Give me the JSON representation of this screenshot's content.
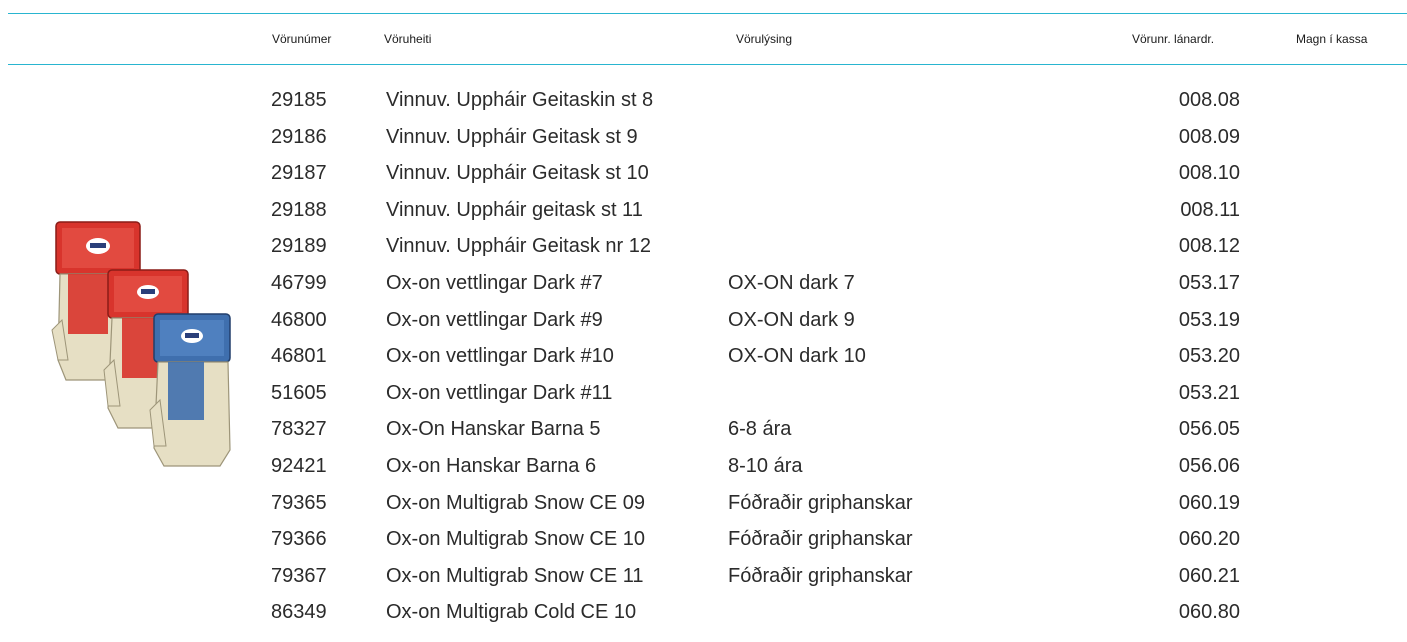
{
  "table": {
    "headers": {
      "number": "Vörunúmer",
      "name": "Vöruheiti",
      "description": "Vörulýsing",
      "supplier_no": "Vörunr. lánardr.",
      "quantity": "Magn í kassa"
    },
    "rows": [
      {
        "number": "29185",
        "name": "Vinnuv. Uppháir Geitaskin st 8",
        "description": "",
        "supplier_no": "008.08"
      },
      {
        "number": "29186",
        "name": "Vinnuv. Uppháir Geitask st 9",
        "description": "",
        "supplier_no": "008.09"
      },
      {
        "number": "29187",
        "name": "Vinnuv. Uppháir Geitask st 10",
        "description": "",
        "supplier_no": "008.10"
      },
      {
        "number": "29188",
        "name": "Vinnuv. Uppháir geitask st 11",
        "description": "",
        "supplier_no": "008.11"
      },
      {
        "number": "29189",
        "name": "Vinnuv. Uppháir Geitask nr 12",
        "description": "",
        "supplier_no": "008.12"
      },
      {
        "number": "46799",
        "name": "Ox-on vettlingar Dark #7",
        "description": "OX-ON dark 7",
        "supplier_no": "053.17"
      },
      {
        "number": "46800",
        "name": "Ox-on vettlingar Dark #9",
        "description": "OX-ON dark 9",
        "supplier_no": "053.19"
      },
      {
        "number": "46801",
        "name": "Ox-on vettlingar Dark #10",
        "description": "OX-ON dark 10",
        "supplier_no": "053.20"
      },
      {
        "number": "51605",
        "name": "Ox-on vettlingar Dark #11",
        "description": "",
        "supplier_no": "053.21"
      },
      {
        "number": "78327",
        "name": "Ox-On Hanskar Barna 5",
        "description": "6-8 ára",
        "supplier_no": "056.05"
      },
      {
        "number": "92421",
        "name": "Ox-on Hanskar Barna 6",
        "description": "8-10 ára",
        "supplier_no": "056.06"
      },
      {
        "number": "79365",
        "name": "Ox-on Multigrab Snow CE 09",
        "description": "Fóðraðir griphanskar",
        "supplier_no": "060.19"
      },
      {
        "number": "79366",
        "name": "Ox-on Multigrab Snow CE 10",
        "description": "Fóðraðir griphanskar",
        "supplier_no": "060.20"
      },
      {
        "number": "79367",
        "name": "Ox-on Multigrab Snow CE 11",
        "description": "Fóðraðir griphanskar",
        "supplier_no": "060.21"
      },
      {
        "number": "86349",
        "name": "Ox-on Multigrab Cold CE 10",
        "description": "",
        "supplier_no": "060.80"
      }
    ]
  },
  "colors": {
    "rule": "#29b5d0",
    "glove_red": "#d8342c",
    "glove_blue": "#3f6fae",
    "glove_leather": "#e6dfc4"
  },
  "image": {
    "icon": "work-gloves-icon"
  }
}
